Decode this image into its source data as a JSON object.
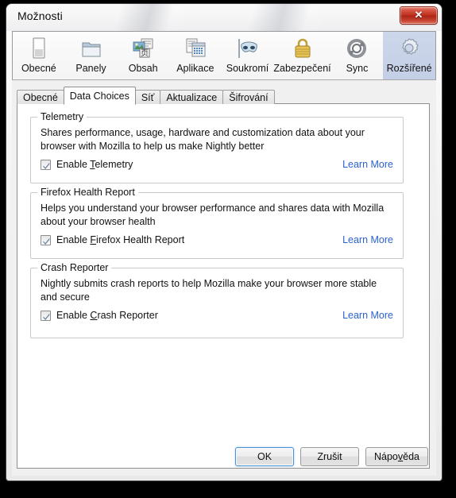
{
  "window": {
    "title": "Možnosti",
    "close_glyph": "✕"
  },
  "prefs_toolbar": {
    "items": [
      {
        "label": "Obecné",
        "icon": "general-icon",
        "selected": false
      },
      {
        "label": "Panely",
        "icon": "tabs-icon",
        "selected": false
      },
      {
        "label": "Obsah",
        "icon": "content-icon",
        "selected": false
      },
      {
        "label": "Aplikace",
        "icon": "apps-icon",
        "selected": false
      },
      {
        "label": "Soukromí",
        "icon": "privacy-icon",
        "selected": false
      },
      {
        "label": "Zabezpečení",
        "icon": "security-icon",
        "selected": false
      },
      {
        "label": "Sync",
        "icon": "sync-icon",
        "selected": false
      },
      {
        "label": "Rozšířené",
        "icon": "advanced-icon",
        "selected": true
      }
    ]
  },
  "tabs": [
    {
      "label": "Obecné",
      "selected": false
    },
    {
      "label": "Data Choices",
      "selected": true
    },
    {
      "label": "Síť",
      "selected": false
    },
    {
      "label": "Aktualizace",
      "selected": false
    },
    {
      "label": "Šifrování",
      "selected": false
    }
  ],
  "groups": [
    {
      "legend": "Telemetry",
      "description": "Shares performance, usage, hardware and customization data about your browser with Mozilla to help us make Nightly better",
      "checkbox_label_pre": "Enable ",
      "checkbox_accesskey": "T",
      "checkbox_label_post": "elemetry",
      "checked": true,
      "link": "Learn More"
    },
    {
      "legend": "Firefox Health Report",
      "description": "Helps you understand your browser performance and shares data with Mozilla about your browser health",
      "checkbox_label_pre": "Enable ",
      "checkbox_accesskey": "F",
      "checkbox_label_post": "irefox Health Report",
      "checked": true,
      "link": "Learn More"
    },
    {
      "legend": "Crash Reporter",
      "description": "Nightly submits crash reports to help Mozilla make your browser more stable and secure",
      "checkbox_label_pre": "Enable ",
      "checkbox_accesskey": "C",
      "checkbox_label_post": "rash Reporter",
      "checked": true,
      "link": "Learn More"
    }
  ],
  "buttons": [
    {
      "label": "OK",
      "default": true,
      "accesskey": ""
    },
    {
      "label": "Zrušit",
      "default": false,
      "accesskey": ""
    },
    {
      "label": "Nápověda",
      "default": false,
      "accesskey": "v"
    }
  ],
  "colors": {
    "link": "#2a62d0",
    "selected_category_bg": "#c8d3e8",
    "close_button_red": "#c0301e",
    "dialog_bg": "#f0f0f0",
    "panel_bg": "#ffffff"
  }
}
